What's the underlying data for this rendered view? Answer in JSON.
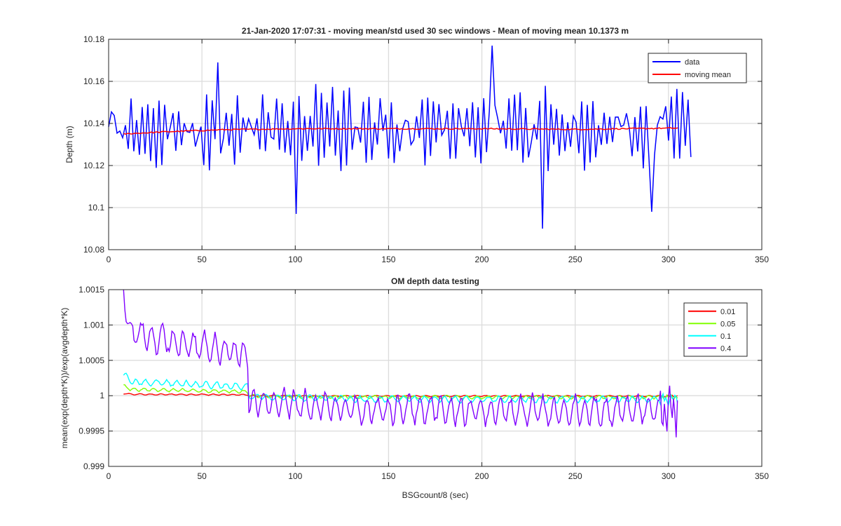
{
  "chart_data": [
    {
      "type": "line",
      "title": "21-Jan-2020 17:07:31 - moving mean/std used 30 sec windows - Mean of moving mean 10.1373 m",
      "xlabel": "",
      "ylabel": "Depth (m)",
      "xlim": [
        0,
        350
      ],
      "ylim": [
        10.08,
        10.18
      ],
      "xticks": [
        "0",
        "50",
        "100",
        "150",
        "200",
        "250",
        "300",
        "350"
      ],
      "yticks": [
        "10.08",
        "10.1",
        "10.12",
        "10.14",
        "10.16",
        "10.18"
      ],
      "grid": true,
      "legend_position": "top-right",
      "series": [
        {
          "name": "data",
          "color": "#0000ff",
          "x_range": [
            0,
            313
          ],
          "sample_step": 1.5,
          "mean": 10.1373,
          "amplitude": 0.018,
          "extremes": [
            {
              "x": 58,
              "y": 10.169
            },
            {
              "x": 101,
              "y": 10.097
            },
            {
              "x": 206,
              "y": 10.177
            },
            {
              "x": 232,
              "y": 10.09
            },
            {
              "x": 291,
              "y": 10.098
            }
          ],
          "style": "oscillating"
        },
        {
          "name": "moving mean",
          "color": "#ff0000",
          "x": [
            8,
            30,
            60,
            100,
            150,
            200,
            250,
            305
          ],
          "y": [
            10.135,
            10.136,
            10.137,
            10.1375,
            10.1375,
            10.1375,
            10.1372,
            10.1378
          ]
        }
      ]
    },
    {
      "type": "line",
      "title": "OM depth data testing",
      "xlabel": "BSGcount/8 (sec)",
      "ylabel": "mean(exp(depth*K))/exp(avgdepth*K)",
      "xlim": [
        0,
        350
      ],
      "ylim": [
        0.999,
        1.0015
      ],
      "xticks": [
        "0",
        "50",
        "100",
        "150",
        "200",
        "250",
        "300",
        "350"
      ],
      "yticks": [
        "0.999",
        "0.9995",
        "1",
        "1.0005",
        "1.001",
        "1.0015"
      ],
      "grid": true,
      "legend_position": "top-right",
      "series": [
        {
          "name": "0.01",
          "color": "#ff0000",
          "x_range": [
            8,
            305
          ],
          "start_offset": 2e-05,
          "late_offset": -5e-06,
          "noise": 8e-06
        },
        {
          "name": "0.05",
          "color": "#80ff00",
          "x_range": [
            8,
            305
          ],
          "start_offset": 9e-05,
          "late_offset": -2e-05,
          "noise": 2e-05
        },
        {
          "name": "0.1",
          "color": "#00ffff",
          "x_range": [
            8,
            305
          ],
          "start_offset": 0.0002,
          "late_offset": -5e-05,
          "noise": 4e-05
        },
        {
          "name": "0.4",
          "color": "#8000ff",
          "x_range": [
            8,
            305
          ],
          "start_offset": 0.0009,
          "late_offset": -0.0002,
          "noise": 0.00018
        }
      ]
    }
  ]
}
